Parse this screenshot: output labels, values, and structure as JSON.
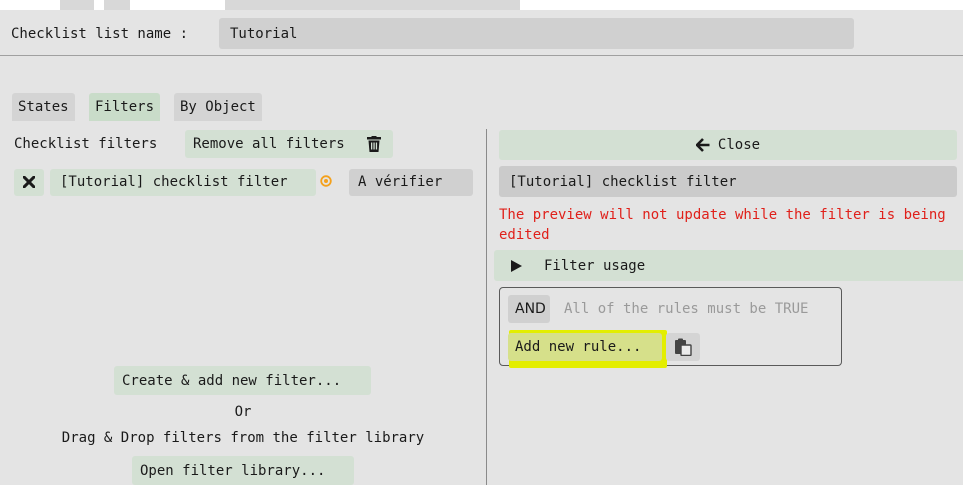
{
  "header": {
    "list_name_label": "Checklist list name :",
    "list_name_value": "Tutorial"
  },
  "tabs": [
    {
      "label": "States",
      "active": false
    },
    {
      "label": "Filters",
      "active": true
    },
    {
      "label": "By Object",
      "active": false
    }
  ],
  "left": {
    "checklist_filters_label": "Checklist filters",
    "remove_all_label": "Remove all filters",
    "filter_row": {
      "name": "[Tutorial] checklist filter",
      "state_label": "A vérifier"
    },
    "create_label": "Create & add new filter...",
    "or_label": "Or",
    "drag_drop_label": "Drag & Drop filters from the filter library",
    "open_library_label": "Open filter library..."
  },
  "right": {
    "close_label": "Close",
    "filter_name": "[Tutorial] checklist filter",
    "warning": "The preview will not update while the filter is being edited",
    "usage_label": "Filter usage",
    "and_label": "AND",
    "and_description": "All of the rules must be TRUE",
    "add_rule_label": "Add new rule..."
  },
  "colors": {
    "background": "#e4e4e4",
    "button_green": "#d3e0d3",
    "active_tab": "#c9dcc9",
    "warning_red": "#e0201a",
    "highlight_yellow": "#e3ee00",
    "orange_dot": "#f4a11c"
  },
  "icons": {
    "remove_all": "trash-icon",
    "remove_filter": "x-icon",
    "filter_status": "circle-dot-icon",
    "close": "arrow-left-icon",
    "usage_toggle": "triangle-right-icon",
    "paste": "clipboard-icon"
  }
}
